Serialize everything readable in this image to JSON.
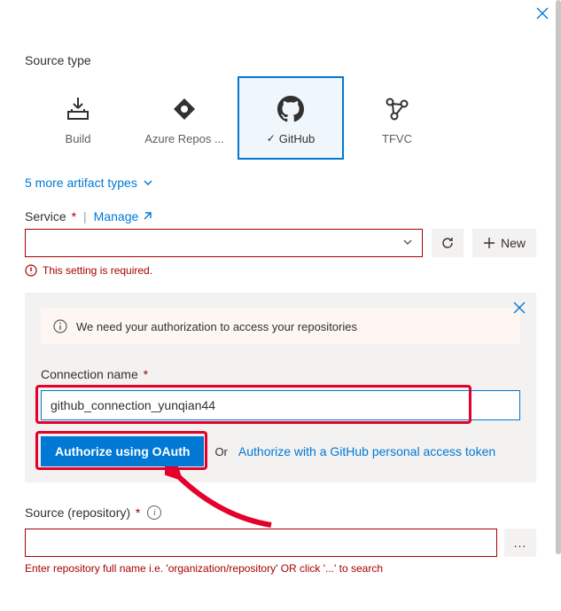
{
  "header": {
    "source_type_label": "Source type"
  },
  "tiles": [
    {
      "label": "Build"
    },
    {
      "label": "Azure Repos ..."
    },
    {
      "label": "GitHub"
    },
    {
      "label": "TFVC"
    }
  ],
  "more_artifacts": "5 more artifact types",
  "service": {
    "label": "Service",
    "manage": "Manage",
    "error": "This setting is required.",
    "new_label": "New"
  },
  "panel": {
    "info": "We need your authorization to access your repositories",
    "conn_label": "Connection name",
    "conn_value": "github_connection_yunqian44",
    "oauth_btn": "Authorize using OAuth",
    "or": "Or",
    "token_link": "Authorize with a GitHub personal access token"
  },
  "source": {
    "label": "Source (repository)",
    "hint": "Enter repository full name i.e. 'organization/repository' OR click '...' to search",
    "browse": "..."
  }
}
